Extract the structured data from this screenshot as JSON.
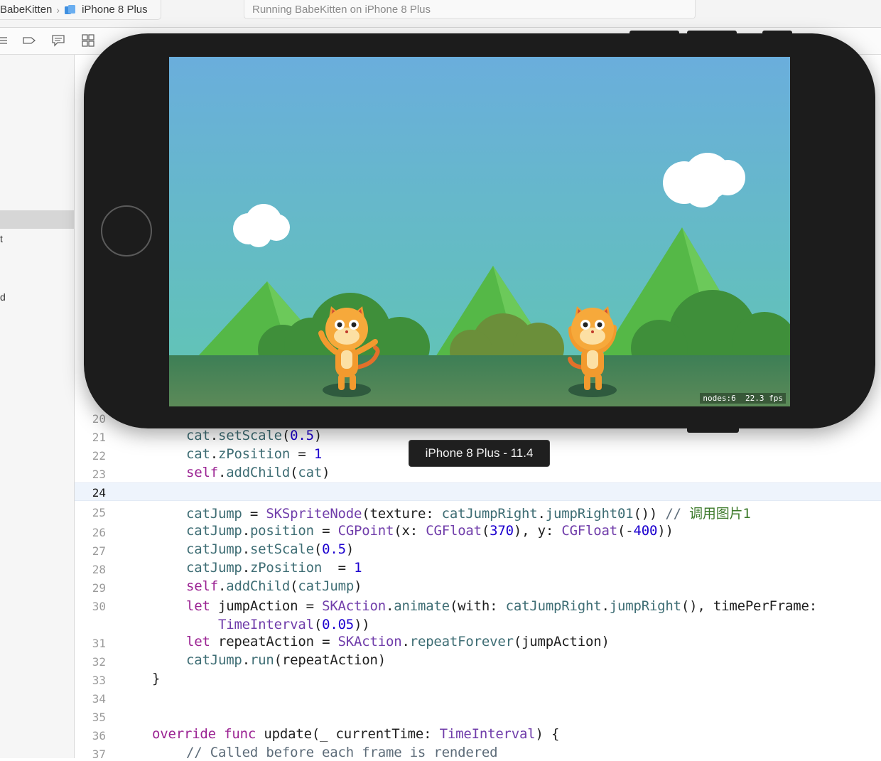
{
  "topbar": {
    "scheme_name": "BabeKitten",
    "device_name": "iPhone 8 Plus",
    "activity_text": "Running BabeKitten on iPhone 8 Plus"
  },
  "navigator": {
    "fragment_1": "t",
    "fragment_2": "d"
  },
  "editor": {
    "lines": [
      {
        "num": "20",
        "text": ""
      },
      {
        "num": "21",
        "text": "cat.setScale(0.5)"
      },
      {
        "num": "22",
        "text": "cat.zPosition = 1"
      },
      {
        "num": "23",
        "text": "self.addChild(cat)"
      },
      {
        "num": "24",
        "text": ""
      },
      {
        "num": "25",
        "text": "catJump = SKSpriteNode(texture: catJumpRight.jumpRight01()) // 调用图片1"
      },
      {
        "num": "26",
        "text": "catJump.position = CGPoint(x: CGFloat(370), y: CGFloat(-400))"
      },
      {
        "num": "27",
        "text": "catJump.setScale(0.5)"
      },
      {
        "num": "28",
        "text": "catJump.zPosition  = 1"
      },
      {
        "num": "29",
        "text": "self.addChild(catJump)"
      },
      {
        "num": "30",
        "text": "let jumpAction = SKAction.animate(with: catJumpRight.jumpRight(), timePerFrame: TimeInterval(0.05))"
      },
      {
        "num": "31",
        "text": "let repeatAction = SKAction.repeatForever(jumpAction)"
      },
      {
        "num": "32",
        "text": "catJump.run(repeatAction)"
      },
      {
        "num": "33",
        "text": "}"
      },
      {
        "num": "34",
        "text": ""
      },
      {
        "num": "35",
        "text": ""
      },
      {
        "num": "36",
        "text": "override func update(_ currentTime: TimeInterval) {"
      },
      {
        "num": "37",
        "text": "// Called before each frame is rendered"
      }
    ],
    "current_line": "24"
  },
  "simulator": {
    "stats_text": "nodes:6  22.3 fps",
    "tooltip": "iPhone 8 Plus - 11.4"
  },
  "colors": {
    "sky_top": "#6aaedc",
    "sky_bottom": "#62c7b4",
    "ground": "#3f7a5a",
    "mountain": "#5bbf4a",
    "cat": "#f6a93b"
  }
}
